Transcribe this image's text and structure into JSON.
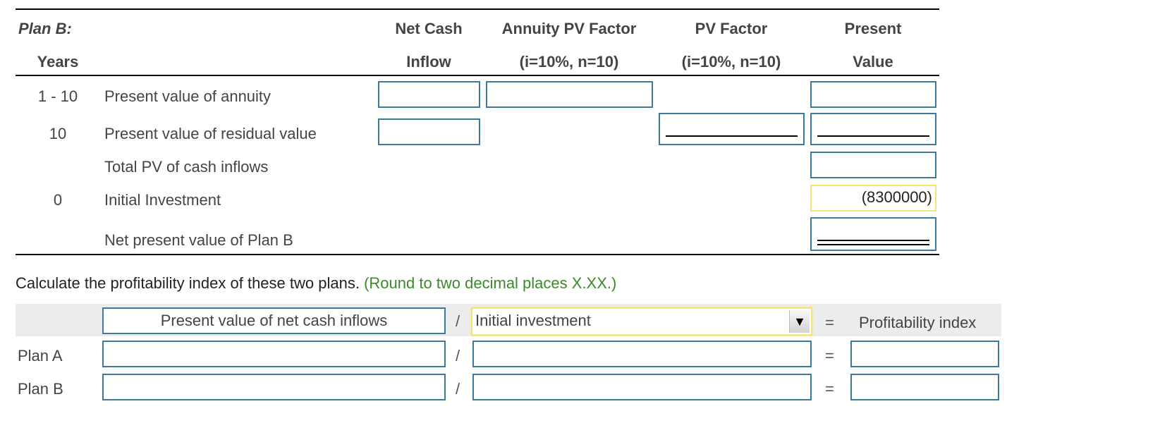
{
  "table": {
    "plan_label": "Plan B:",
    "headers": {
      "years": "Years",
      "net_cash": [
        "Net Cash",
        "Inflow"
      ],
      "annuity_pv": [
        "Annuity PV Factor",
        "(i=10%, n=10)"
      ],
      "pv_factor": [
        "PV Factor",
        "(i=10%, n=10)"
      ],
      "present_value": [
        "Present",
        "Value"
      ]
    },
    "rows": [
      {
        "years": "1 - 10",
        "label": "Present value of annuity"
      },
      {
        "years": "10",
        "label": "Present value of residual value"
      },
      {
        "years": "",
        "label": "Total PV of cash inflows"
      },
      {
        "years": "0",
        "label": "Initial Investment",
        "present_value": "(8300000)"
      },
      {
        "years": "",
        "label": "Net present value of Plan B"
      }
    ]
  },
  "prompt": {
    "text": "Calculate the profitability index of these two plans. ",
    "hint": "(Round to two decimal places X.XX.)"
  },
  "pi_table": {
    "numerator_header": "Present value of net cash inflows",
    "divide_symbol": "/",
    "denominator_select": {
      "selected": "Initial investment",
      "arrow_icon": "▼"
    },
    "equals_symbol": "=",
    "result_header": "Profitability index",
    "rows": [
      {
        "label": "Plan A"
      },
      {
        "label": "Plan B"
      }
    ]
  },
  "colors": {
    "input_border": "#3b7a9a",
    "highlight_border": "#f3e17a",
    "hint_green": "#3a8a2a"
  }
}
